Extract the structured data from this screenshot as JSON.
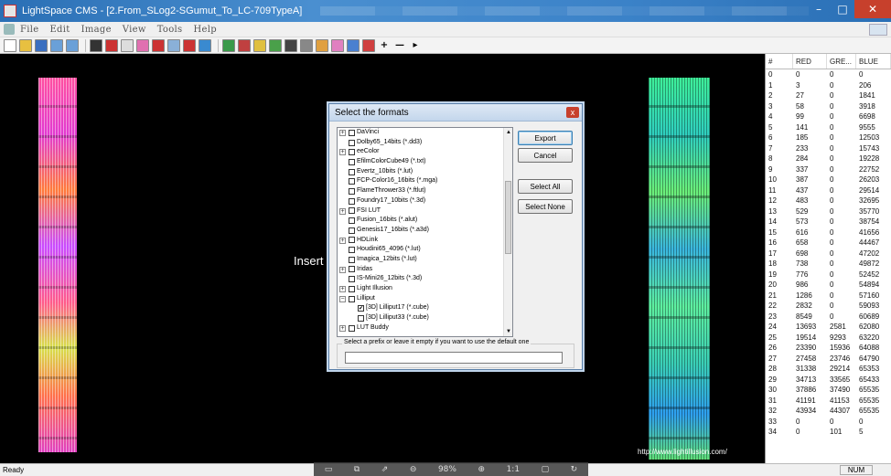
{
  "window": {
    "title": "LightSpace CMS - [2.From_SLog2-SGumut_To_LC-709TypeA]",
    "min": "–",
    "max": "□",
    "close": "✕"
  },
  "menu": [
    "File",
    "Edit",
    "Image",
    "View",
    "Tools",
    "Help"
  ],
  "toolbar": {
    "plus": "+",
    "minus": "—",
    "more": "▸"
  },
  "canvas": {
    "insert_text": "Insert",
    "url": "http://www.lightillusion.com/"
  },
  "dialog": {
    "title": "Select the formats",
    "close": "x",
    "export": "Export",
    "cancel": "Cancel",
    "select_all": "Select All",
    "select_none": "Select None",
    "prefix_label": "Select a prefix or leave it empty if you want to use the default one",
    "prefix_value": "",
    "items": [
      {
        "label": "DaVinci",
        "expander": "+",
        "indent": 0,
        "checked": false
      },
      {
        "label": "Dolby65_14bits (*.dd3)",
        "expander": "",
        "indent": 1,
        "checked": false
      },
      {
        "label": "eeColor",
        "expander": "+",
        "indent": 0,
        "checked": false
      },
      {
        "label": "EfilmColorCube49 (*.txt)",
        "expander": "",
        "indent": 1,
        "checked": false
      },
      {
        "label": "Evertz_10bits (*.lut)",
        "expander": "",
        "indent": 1,
        "checked": false
      },
      {
        "label": "FCP-Color16_16bits (*.mga)",
        "expander": "",
        "indent": 1,
        "checked": false
      },
      {
        "label": "FlameThrower33 (*.ftlut)",
        "expander": "",
        "indent": 1,
        "checked": false
      },
      {
        "label": "Foundry17_10bits (*.3d)",
        "expander": "",
        "indent": 1,
        "checked": false
      },
      {
        "label": "FSI LUT",
        "expander": "+",
        "indent": 0,
        "checked": false
      },
      {
        "label": "Fusion_16bits (*.alut)",
        "expander": "",
        "indent": 1,
        "checked": false
      },
      {
        "label": "Genesis17_16bits (*.a3d)",
        "expander": "",
        "indent": 1,
        "checked": false
      },
      {
        "label": "HDLink",
        "expander": "+",
        "indent": 0,
        "checked": false
      },
      {
        "label": "Houdini65_4096 (*.lut)",
        "expander": "",
        "indent": 1,
        "checked": false
      },
      {
        "label": "Imagica_12bits (*.lut)",
        "expander": "",
        "indent": 1,
        "checked": false
      },
      {
        "label": "Iridas",
        "expander": "+",
        "indent": 0,
        "checked": false
      },
      {
        "label": "IS-Mini26_12bits (*.3d)",
        "expander": "",
        "indent": 1,
        "checked": false
      },
      {
        "label": "Light Illusion",
        "expander": "+",
        "indent": 0,
        "checked": false
      },
      {
        "label": "Lilliput",
        "expander": "−",
        "indent": 0,
        "checked": false
      },
      {
        "label": "[3D] Lilliput17 (*.cube)",
        "expander": "",
        "indent": 2,
        "checked": true
      },
      {
        "label": "[3D] Lilliput33 (*.cube)",
        "expander": "",
        "indent": 2,
        "checked": false
      },
      {
        "label": "LUT Buddy",
        "expander": "+",
        "indent": 0,
        "checked": false
      }
    ]
  },
  "table": {
    "headers": [
      "#",
      "RED",
      "GRE...",
      "BLUE"
    ],
    "rows": [
      [
        "0",
        "0",
        "0",
        "0"
      ],
      [
        "1",
        "3",
        "0",
        "206"
      ],
      [
        "2",
        "27",
        "0",
        "1841"
      ],
      [
        "3",
        "58",
        "0",
        "3918"
      ],
      [
        "4",
        "99",
        "0",
        "6698"
      ],
      [
        "5",
        "141",
        "0",
        "9555"
      ],
      [
        "6",
        "185",
        "0",
        "12503"
      ],
      [
        "7",
        "233",
        "0",
        "15743"
      ],
      [
        "8",
        "284",
        "0",
        "19228"
      ],
      [
        "9",
        "337",
        "0",
        "22752"
      ],
      [
        "10",
        "387",
        "0",
        "26203"
      ],
      [
        "11",
        "437",
        "0",
        "29514"
      ],
      [
        "12",
        "483",
        "0",
        "32695"
      ],
      [
        "13",
        "529",
        "0",
        "35770"
      ],
      [
        "14",
        "573",
        "0",
        "38754"
      ],
      [
        "15",
        "616",
        "0",
        "41656"
      ],
      [
        "16",
        "658",
        "0",
        "44467"
      ],
      [
        "17",
        "698",
        "0",
        "47202"
      ],
      [
        "18",
        "738",
        "0",
        "49872"
      ],
      [
        "19",
        "776",
        "0",
        "52452"
      ],
      [
        "20",
        "986",
        "0",
        "54894"
      ],
      [
        "21",
        "1286",
        "0",
        "57160"
      ],
      [
        "22",
        "2832",
        "0",
        "59093"
      ],
      [
        "23",
        "8549",
        "0",
        "60689"
      ],
      [
        "24",
        "13693",
        "2581",
        "62080"
      ],
      [
        "25",
        "19514",
        "9293",
        "63220"
      ],
      [
        "26",
        "23390",
        "15936",
        "64088"
      ],
      [
        "27",
        "27458",
        "23746",
        "64790"
      ],
      [
        "28",
        "31338",
        "29214",
        "65353"
      ],
      [
        "29",
        "34713",
        "33565",
        "65433"
      ],
      [
        "30",
        "37886",
        "37490",
        "65535"
      ],
      [
        "31",
        "41191",
        "41153",
        "65535"
      ],
      [
        "32",
        "43934",
        "44307",
        "65535"
      ],
      [
        "33",
        "0",
        "0",
        "0"
      ],
      [
        "34",
        "0",
        "101",
        "5"
      ]
    ]
  },
  "status": {
    "left": "Ready",
    "num": "NUM"
  },
  "viewer": {
    "zoom": "98%",
    "one_to_one": "1:1"
  }
}
